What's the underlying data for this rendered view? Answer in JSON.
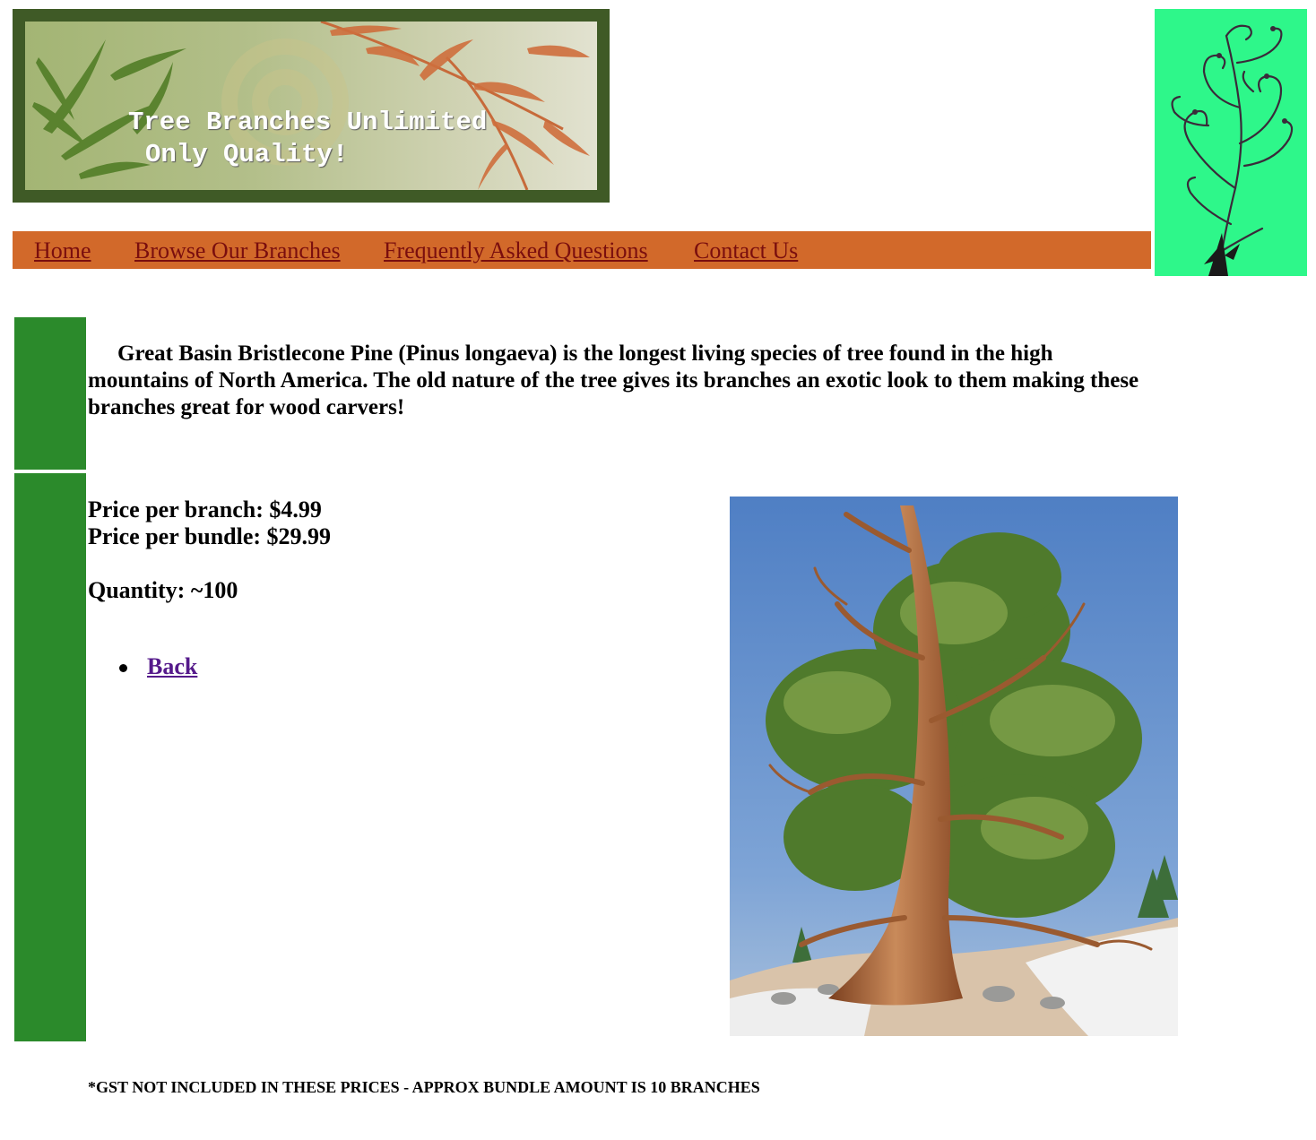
{
  "banner": {
    "title": "Tree Branches Unlimited",
    "subtitle": "Only Quality!"
  },
  "nav": {
    "items": [
      {
        "label": "Home"
      },
      {
        "label": "Browse Our Branches"
      },
      {
        "label": "Frequently Asked Questions"
      },
      {
        "label": "Contact Us"
      }
    ]
  },
  "product": {
    "description": "Great Basin Bristlecone Pine (Pinus longaeva) is the longest living species of tree found in the high mountains of North America. The old nature of the tree gives its branches an exotic look to them making these branches great for wood carvers!",
    "price_branch": "Price per branch: $4.99",
    "price_bundle": "Price per bundle: $29.99",
    "quantity": "Quantity: ~100",
    "back_label": "Back",
    "footnote": "*GST NOT INCLUDED IN THESE PRICES - APPROX BUNDLE AMOUNT IS 10 BRANCHES"
  },
  "colors": {
    "nav_bar": "#d2692a",
    "nav_link": "#7a0e0e",
    "sidebar": "#2b8a2b",
    "ornament_bg": "#2ef78a",
    "banner_frame": "#3f5a26",
    "visited_link": "#551a8b"
  },
  "icons": {
    "banner_art": "bamboo-leaves-illustration",
    "ornament": "swirl-vine-ornament",
    "tree": "bristlecone-pine-painting"
  }
}
